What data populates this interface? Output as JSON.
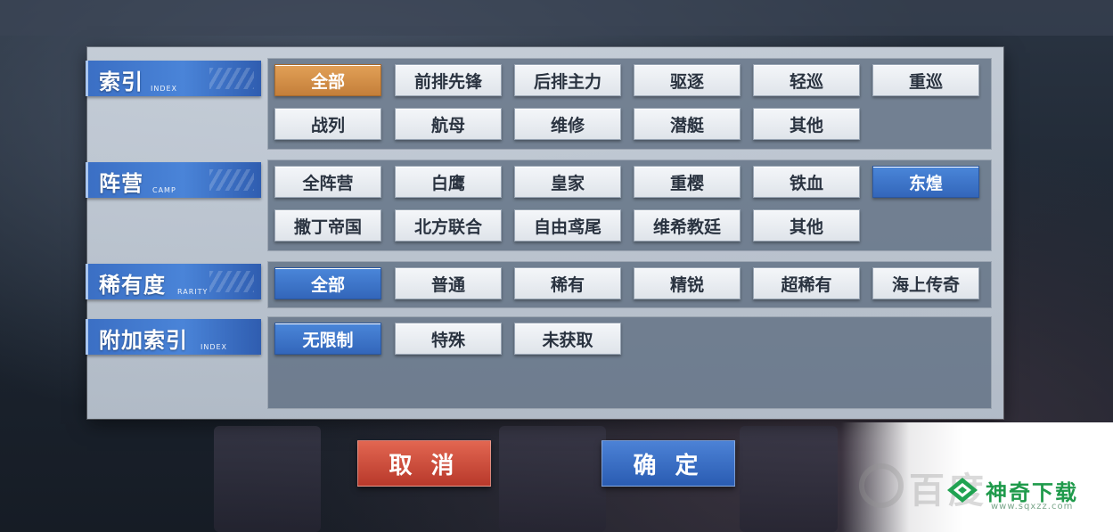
{
  "sections": {
    "index": {
      "title": "索引",
      "subtitle": "INDEX",
      "options": [
        "全部",
        "前排先锋",
        "后排主力",
        "驱逐",
        "轻巡",
        "重巡",
        "战列",
        "航母",
        "维修",
        "潜艇",
        "其他"
      ]
    },
    "camp": {
      "title": "阵营",
      "subtitle": "CAMP",
      "options": [
        "全阵营",
        "白鹰",
        "皇家",
        "重樱",
        "铁血",
        "东煌",
        "撒丁帝国",
        "北方联合",
        "自由鸢尾",
        "维希教廷",
        "其他"
      ]
    },
    "rarity": {
      "title": "稀有度",
      "subtitle": "RARITY",
      "options": [
        "全部",
        "普通",
        "稀有",
        "精锐",
        "超稀有",
        "海上传奇"
      ]
    },
    "extra": {
      "title": "附加索引",
      "subtitle": "INDEX",
      "options": [
        "无限制",
        "特殊",
        "未获取"
      ]
    }
  },
  "actions": {
    "cancel": "取 消",
    "confirm": "确 定"
  },
  "watermark": {
    "brand": "神奇下载",
    "url": "www.sqxzz.com",
    "faint_text": "百度"
  },
  "colors": {
    "selected_orange": "#d18d45",
    "selected_blue": "#3d74c8",
    "cancel_red": "#c94a3a",
    "confirm_blue": "#3b6fc4"
  }
}
